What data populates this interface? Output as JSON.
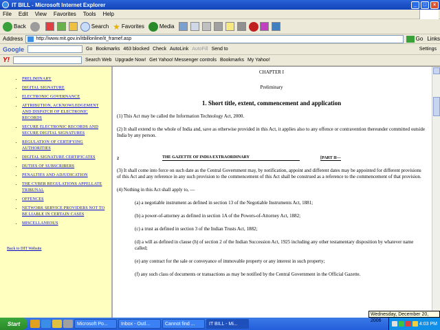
{
  "window": {
    "title": "IT BILL - Microsoft Internet Explorer"
  },
  "menu": [
    "File",
    "Edit",
    "View",
    "Favorites",
    "Tools",
    "Help"
  ],
  "toolbar": {
    "back": "Back",
    "search": "Search",
    "favorites": "Favorites",
    "media": "Media"
  },
  "address": {
    "label": "Address",
    "url": "http://www.mit.gov.in/itbillonline/it_framef.asp",
    "go": "Go",
    "links": "Links"
  },
  "google_bar": {
    "go": "Go",
    "bookmarks": "Bookmarks",
    "blocked": "463 blocked",
    "check": "Check",
    "autolink": "AutoLink",
    "autofill": "AutoFill",
    "sendto": "Send to",
    "settings": "Settings"
  },
  "yahoo_bar": {
    "search_web": "Search Web",
    "upgrade": "Upgrade Now!",
    "messenger": "Get Yahoo! Messenger controls",
    "bookmarks": "Bookmarks",
    "my_yahoo": "My Yahoo!"
  },
  "nav": {
    "items": [
      "PRELIMINARY",
      "DIGITAL SIGNATURE",
      "ELECTRONIC GOVERNANCE",
      "ATTRIBUTION, ACKNOWLEDGEMENT AND DISPATCH OF ELECTRONIC RECORDS",
      "SECURE ELECTRONIC RECORDS AND SECURE DIGITAL SIGNATURES",
      "REGULATION OF CERTIFYING AUTHORITIES",
      "DIGITAL SIGNATURE CERTIFICATES",
      "DUTIES OF SUBSCRIBERS",
      "PENALTIES AND ADJUDICATION",
      "THE CYBER REGULATIONS APPELLATE TRIBUNAL",
      "OFFENCES",
      "NETWORK SERVICE PROVIDERS NOT TO BE LIABLE IN CERTAIN CASES",
      "MISCELLANEOUS"
    ],
    "back_link": "Back to DIT Website"
  },
  "doc": {
    "chapter": "CHAPTER I",
    "subtitle": "Preliminary",
    "heading": "1. Short title, extent, commencement and application",
    "p1": "(1) This Act may be called the Information Technology Act, 2000.",
    "p2": "(2) It shall extend to the whole of India and, save as otherwise provided in this Act, it applies also to any offence or contravention thereunder committed outside India by any person.",
    "gazette_page": "2",
    "gazette_title": "THE GAZETTE OF INDIA EXTRAORDINARY",
    "gazette_part": "[PART II—",
    "p3": "(3) It shall come into force on such date as the Central Government may, by notification, appoint and different dates may be appointed for different provisions of this Act and any reference in any such provision to the commencement of this Act shall be construed as a reference to the commencement of that provision.",
    "p4": "(4) Nothing in this Act shall apply to, —",
    "a": "(a) a negotiable instrument as defined in section 13 of the Negotiable Instruments Act, 1881;",
    "b": "(b) a power-of-attorney as defined in section 1A of the Powers-of-Attorney Act, 1882;",
    "c": "(c) a trust as defined in section 3 of the Indian Trusts Act, 1882;",
    "d": "(d) a will as defined in clause (h) of section 2 of the Indian Succession Act, 1925 including any other testamentary disposition by whatever name called;",
    "e": "(e) any contract for the sale or conveyance of immovable property or any interest in such property;",
    "f": "(f) any such class of documents or transactions as may be notified by the Central Government in the Official Gazette."
  },
  "taskbar": {
    "start": "Start",
    "tasks": [
      "Microsoft Po...",
      "Inbox - Outl...",
      "Cannot find ...",
      "IT BILL - Mi..."
    ],
    "time": "4:03 PM",
    "tooltip": "Wednesday, December 20, 2006"
  }
}
